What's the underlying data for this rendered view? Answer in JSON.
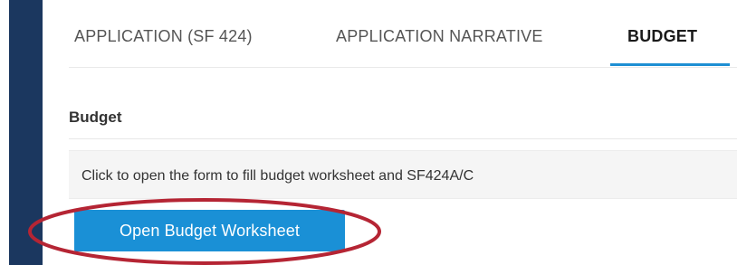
{
  "tabs": [
    {
      "label": "APPLICATION (SF 424)"
    },
    {
      "label": "APPLICATION NARRATIVE"
    },
    {
      "label": "BUDGET"
    }
  ],
  "active_tab": "BUDGET",
  "section": {
    "title": "Budget",
    "notice": "Click to open the form to fill budget worksheet and SF424A/C"
  },
  "button": {
    "label": "Open Budget Worksheet"
  },
  "colors": {
    "nav_bar": "#1b375f",
    "accent": "#1e8fd3",
    "button": "#1a90d6",
    "annotation": "#b52534"
  }
}
